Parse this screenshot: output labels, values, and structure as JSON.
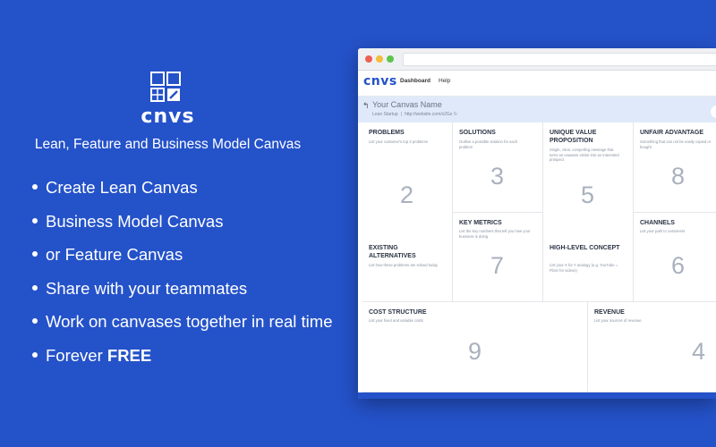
{
  "brand": {
    "name": "cnvs",
    "tagline": "Lean, Feature and Business Model Canvas"
  },
  "features": [
    "Create Lean Canvas",
    "Business Model Canvas",
    "or Feature Canvas",
    "Share with your teammates",
    "Work on canvases together in real time"
  ],
  "last_feature": {
    "prefix": "Forever ",
    "bold": "FREE"
  },
  "app": {
    "logo": "cnvs",
    "nav": {
      "dashboard": "Dashboard",
      "help": "Help"
    },
    "canvas_header": {
      "name": "Your Canvas Name",
      "type": "Lean Startup",
      "sep": "|",
      "url": "http://website.com/x2Gx",
      "url_icon": "↻"
    },
    "cells": {
      "problems": {
        "title": "Problems",
        "desc": "List your customer's top 3 problems",
        "num": "2"
      },
      "existing": {
        "title": "Existing Alternatives",
        "desc": "List how these problems are solved today"
      },
      "solutions": {
        "title": "Solutions",
        "desc": "Outline a possible solution for each problem",
        "num": "3"
      },
      "metrics": {
        "title": "Key Metrics",
        "desc": "List the key numbers that tell you how your business is doing",
        "num": "7"
      },
      "uvp": {
        "title": "Unique Value Proposition",
        "desc": "Single, clear, compelling message that turns an unaware visitor into an interested prospect",
        "num": "5"
      },
      "concept": {
        "title": "High-Level Concept",
        "desc": "List your X for Y analogy (e.g. YouTube = Flickr for videos)"
      },
      "advantage": {
        "title": "Unfair Advantage",
        "desc": "Something that can not be easily copied or bought",
        "num": "8"
      },
      "channels": {
        "title": "Channels",
        "desc": "List your path to customers",
        "num": "6"
      },
      "costs": {
        "title": "Cost Structure",
        "desc": "List your fixed and variable costs",
        "num": "9"
      },
      "revenue": {
        "title": "Revenue",
        "desc": "List your sources of revenue",
        "num": "4"
      }
    }
  },
  "colors": {
    "background": "#2452c9",
    "accent": "#2452c9",
    "canvas_header": "#dfe9f9"
  },
  "icons": {
    "logo": "canvas-grid-icon",
    "back": "back-arrow-icon",
    "refresh": "refresh-icon"
  }
}
